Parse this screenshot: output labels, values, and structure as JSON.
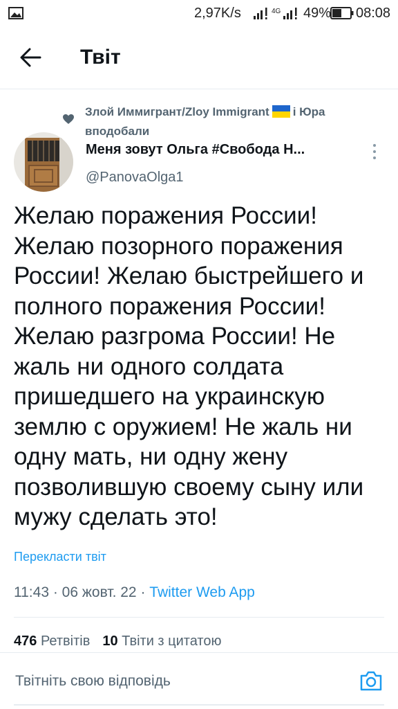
{
  "status_bar": {
    "speed": "2,97K/s",
    "network": "4G",
    "battery": "49%",
    "time": "08:08",
    "icons": [
      "gallery-icon",
      "signal-icon",
      "battery-icon"
    ]
  },
  "header": {
    "title": "Твіт",
    "back_icon": "arrow-left-icon"
  },
  "social_context": {
    "text_before": "Злой Иммигрант/Zloy Immigrant",
    "text_after": "і Юра вподобали",
    "icon": "heart-icon"
  },
  "author": {
    "name": "Меня зовут Ольга #Свобода Н...",
    "handle": "@PanovaOlga1"
  },
  "tweet": {
    "text": "Желаю поражения России!\nЖелаю позорного поражения\nРоссии! Желаю быстрейшего и\nполного поражения России!\nЖелаю разгрома России! Не\nжаль ни одного солдата\nпришедшего на украинскую\nземлю с оружием! Не жаль ни\nодну мать, ни одну жену\nпозволившую своему сыну или\nмужу сделать это!",
    "translate_label": "Перекласти твіт",
    "time": "11:43",
    "date": "06 жовт. 22",
    "source": "Twitter Web App"
  },
  "stats": {
    "retweets_count": "476",
    "retweets_label": "Ретвітів",
    "quotes_count": "10",
    "quotes_label": "Твіти з цитатою"
  },
  "reply": {
    "placeholder": "Твітніть свою відповідь",
    "icon": "camera-icon"
  },
  "colors": {
    "accent": "#1d9bf0",
    "secondary_text": "#536471",
    "primary_text": "#0f1419",
    "divider": "#e6ecf0",
    "flag_blue": "#1e66cc",
    "flag_yellow": "#ffd500"
  }
}
